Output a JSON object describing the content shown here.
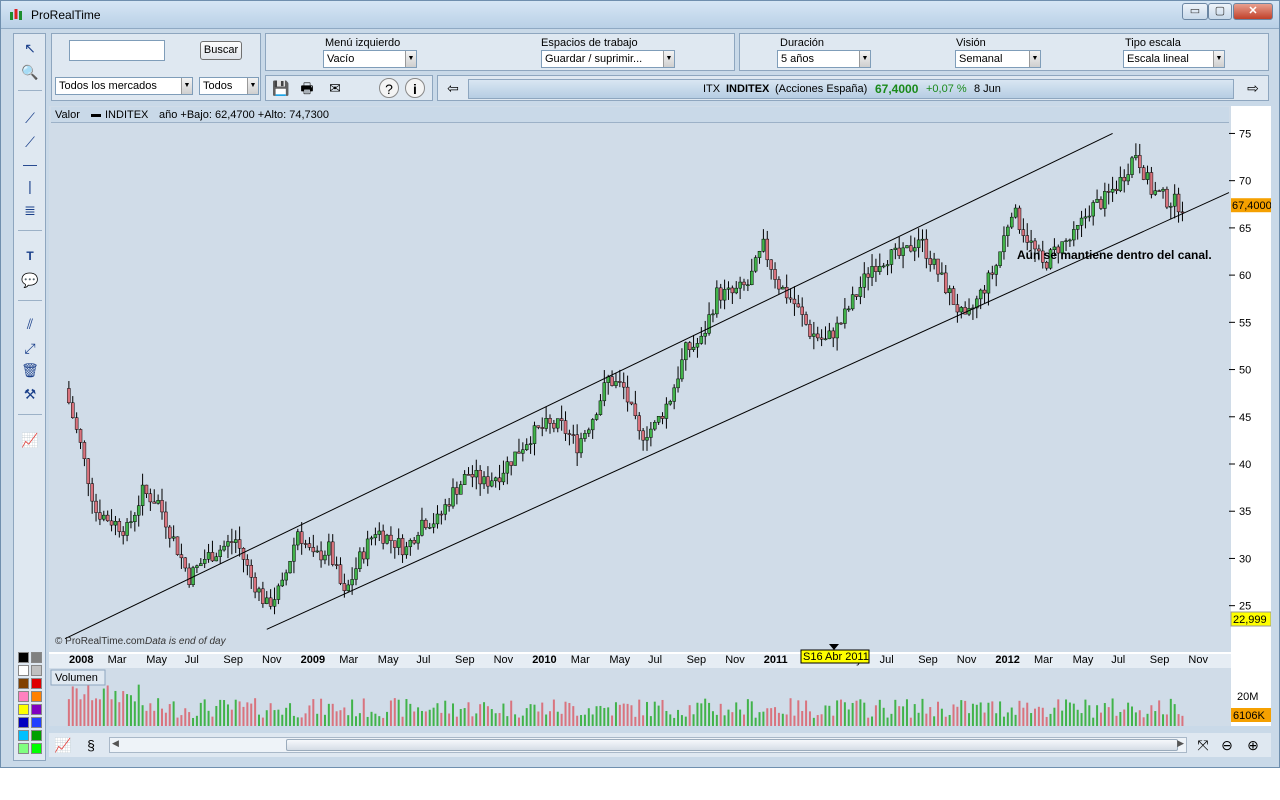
{
  "window": {
    "title": "ProRealTime",
    "minimize": "▭",
    "maximize": "▢",
    "close": "✕"
  },
  "search": {
    "value": "",
    "button": "Buscar"
  },
  "filters": {
    "markets": "Todos los mercados",
    "type": "Todos"
  },
  "menus": {
    "left_menu": {
      "label": "Menú izquierdo",
      "value": "Vacío"
    },
    "workspaces": {
      "label": "Espacios de trabajo",
      "value": "Guardar / suprimir..."
    },
    "duration": {
      "label": "Duración",
      "value": "5 años"
    },
    "vision": {
      "label": "Visión",
      "value": "Semanal"
    },
    "scale": {
      "label": "Tipo escala",
      "value": "Escala lineal"
    }
  },
  "quote": {
    "ticker": "ITX",
    "name": "INDITEX",
    "market": "(Acciones España)",
    "price": "67,4000",
    "change": "+0,07 %",
    "date": "8 Jun"
  },
  "chart_info": {
    "value_label": "Valor",
    "instrument": "INDITEX",
    "range": "año +Bajo: 62,4700 +Alto: 74,7300",
    "watermark": "© ProRealTime.com",
    "eod_note": "Data is end of day",
    "annotation": "Aún se mantiene dentro del canal.",
    "last_price_tag": "67,4000",
    "low_tag": "22,999",
    "cursor_date": "S16 Abr 2011"
  },
  "volume": {
    "label": "Volumen",
    "scale_label": "20M",
    "last_tag": "6106K"
  },
  "colors": {
    "up": "#41b34a",
    "down": "#d9737e",
    "chart_bg": "#d0dce8",
    "price_tag": "#f5a000",
    "low_tag": "#ffff00"
  },
  "chart_data": {
    "type": "candlestick",
    "title": "",
    "xlabel": "",
    "ylabel": "",
    "y_ticks": [
      25,
      30,
      35,
      40,
      45,
      50,
      55,
      60,
      65,
      70,
      75
    ],
    "ylim": [
      22,
      76
    ],
    "x_ticks": [
      "2008",
      "Mar",
      "May",
      "Jul",
      "Sep",
      "Nov",
      "2009",
      "Mar",
      "May",
      "Jul",
      "Sep",
      "Nov",
      "2010",
      "Mar",
      "May",
      "Jul",
      "Sep",
      "Nov",
      "2011",
      "Mar",
      "May",
      "Jul",
      "Sep",
      "Nov",
      "2012",
      "Mar",
      "May",
      "Jul",
      "Sep",
      "Nov"
    ],
    "approx_close_path": [
      [
        0,
        48
      ],
      [
        4,
        42
      ],
      [
        8,
        35
      ],
      [
        12,
        34
      ],
      [
        16,
        33
      ],
      [
        20,
        37
      ],
      [
        24,
        36
      ],
      [
        28,
        32
      ],
      [
        32,
        28
      ],
      [
        36,
        30
      ],
      [
        40,
        31
      ],
      [
        44,
        32
      ],
      [
        48,
        28
      ],
      [
        52,
        25
      ],
      [
        56,
        27
      ],
      [
        60,
        33
      ],
      [
        64,
        30
      ],
      [
        68,
        31
      ],
      [
        72,
        26
      ],
      [
        76,
        30
      ],
      [
        80,
        33
      ],
      [
        84,
        32
      ],
      [
        88,
        31
      ],
      [
        92,
        34
      ],
      [
        96,
        34
      ],
      [
        100,
        37
      ],
      [
        104,
        39
      ],
      [
        108,
        38
      ],
      [
        112,
        39
      ],
      [
        116,
        41
      ],
      [
        120,
        43
      ],
      [
        124,
        44
      ],
      [
        128,
        44
      ],
      [
        132,
        42
      ],
      [
        136,
        45
      ],
      [
        140,
        49
      ],
      [
        144,
        48
      ],
      [
        148,
        43
      ],
      [
        152,
        44
      ],
      [
        156,
        47
      ],
      [
        160,
        52
      ],
      [
        164,
        53
      ],
      [
        168,
        58
      ],
      [
        172,
        58
      ],
      [
        176,
        59
      ],
      [
        180,
        63
      ],
      [
        184,
        59
      ],
      [
        188,
        57
      ],
      [
        192,
        54
      ],
      [
        196,
        53
      ],
      [
        200,
        55
      ],
      [
        204,
        58
      ],
      [
        208,
        61
      ],
      [
        212,
        62
      ],
      [
        216,
        62
      ],
      [
        220,
        64
      ],
      [
        224,
        61
      ],
      [
        228,
        58
      ],
      [
        232,
        55
      ],
      [
        236,
        58
      ],
      [
        240,
        61
      ],
      [
        244,
        67
      ],
      [
        248,
        64
      ],
      [
        252,
        61
      ],
      [
        256,
        63
      ],
      [
        260,
        64
      ],
      [
        264,
        67
      ],
      [
        268,
        68
      ],
      [
        272,
        70
      ],
      [
        276,
        73
      ],
      [
        280,
        69
      ],
      [
        284,
        68
      ],
      [
        288,
        67.4
      ]
    ],
    "channel_upper": {
      "start": [
        0,
        21.5
      ],
      "end": [
        270,
        75
      ]
    },
    "channel_lower": {
      "start": [
        52,
        22.5
      ],
      "end": [
        288,
        66.5
      ]
    },
    "volume_scale": "20M"
  }
}
